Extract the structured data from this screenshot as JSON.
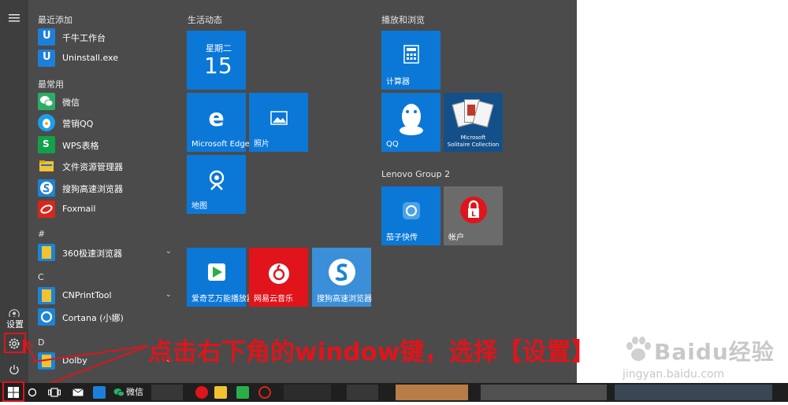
{
  "start_menu": {
    "rail": {
      "hamburger_icon": "hamburger-icon",
      "settings_tooltip": "设置"
    },
    "app_list": {
      "recently_added_header": "最近添加",
      "recently_added": [
        {
          "label": "千牛工作台"
        },
        {
          "label": "Uninstall.exe"
        }
      ],
      "most_used_header": "最常用",
      "most_used": [
        {
          "label": "微信"
        },
        {
          "label": "营销QQ"
        },
        {
          "label": "WPS表格"
        },
        {
          "label": "文件资源管理器"
        },
        {
          "label": "搜狗高速浏览器"
        },
        {
          "label": "Foxmail"
        }
      ],
      "hash_header": "#",
      "hash_items": [
        {
          "label": "360极速浏览器"
        }
      ],
      "c_header": "C",
      "c_items": [
        {
          "label": "CNPrintTool"
        },
        {
          "label": "Cortana (小娜)"
        }
      ],
      "d_header": "D",
      "d_items": [
        {
          "label": "Dolby"
        }
      ]
    },
    "tile_groups": {
      "life_header": "生活动态",
      "play_header": "播放和浏览",
      "lenovo_header": "Lenovo Group 2"
    },
    "tiles": {
      "calendar_weekday": "星期二",
      "calendar_day": "15",
      "edge_label": "Microsoft Edge",
      "photos_label": "照片",
      "maps_label": "地图",
      "calculator_label": "计算器",
      "qq_label": "QQ",
      "solitaire_line1": "Microsoft",
      "solitaire_line2": "Solitaire Collection",
      "lenovo_label": "茄子快传",
      "account_label": "帐户",
      "iqiyi_label": "爱奇艺万能播放器",
      "netease_label": "网易云音乐",
      "sogou_label": "搜狗高速浏览器"
    }
  },
  "annotation": {
    "text": "点击右下角的window键，选择【设置】",
    "color": "#e0141a"
  },
  "watermark": {
    "big": "Baidu经验",
    "small": "jingyan.baidu.com"
  },
  "taskbar": {
    "wechat_label": "微信"
  },
  "colors": {
    "tile_blue": "#0b78d7",
    "menu_bg": "#4b4b4b",
    "netease_red": "#e0141a"
  }
}
